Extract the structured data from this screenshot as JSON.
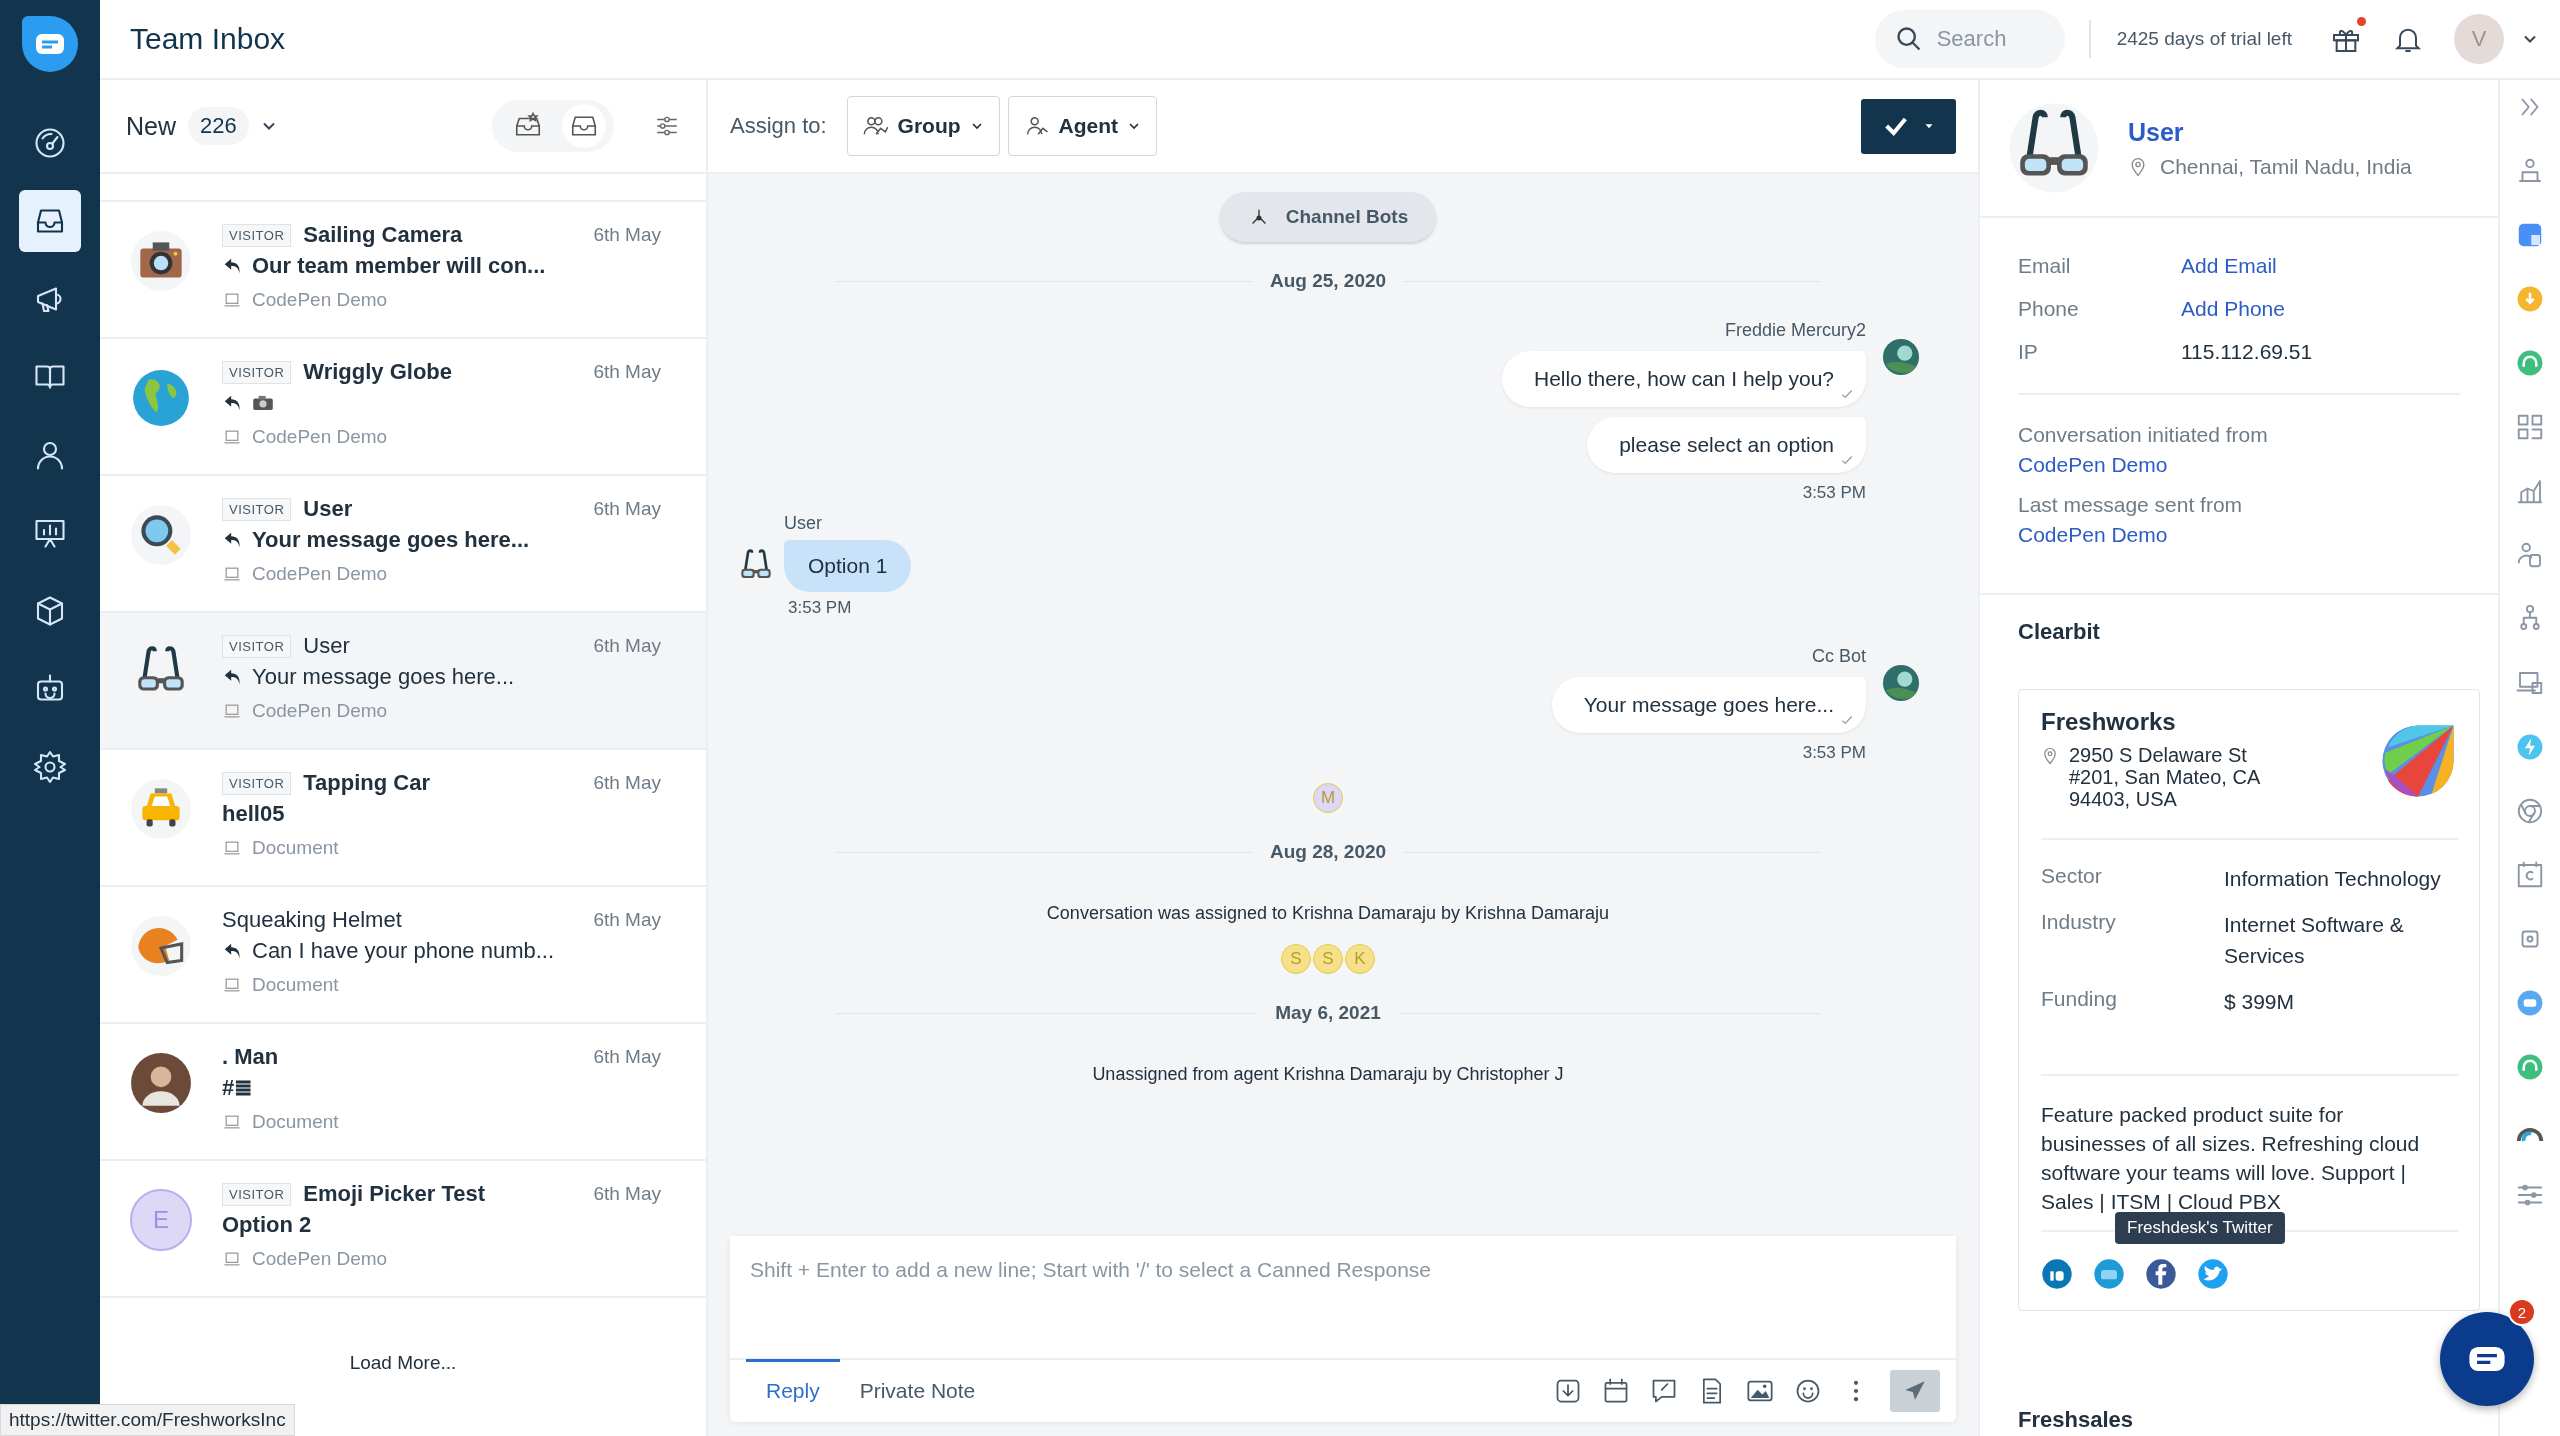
{
  "nav": {
    "items": [
      {
        "selected": false
      },
      {
        "selected": true
      },
      {
        "selected": false
      },
      {
        "selected": false
      },
      {
        "selected": false
      },
      {
        "selected": false
      },
      {
        "selected": false
      },
      {
        "selected": false
      },
      {
        "selected": false
      }
    ]
  },
  "header": {
    "title": "Team Inbox",
    "search": {
      "placeholder": "Search"
    },
    "trial": "2425 days of trial left",
    "gift_notification": true,
    "avatar_initial": "V"
  },
  "list": {
    "filter": "New",
    "count": "226",
    "view_toggle": [
      {
        "selected": false
      },
      {
        "selected": true
      }
    ],
    "load_more": "Load More...",
    "conversations": [
      {
        "badge": "VISITOR",
        "name": "Sailing Camera",
        "unread": true,
        "replied": true,
        "preview": "Our team member will con...",
        "source": "CodePen Demo",
        "date": "6th May",
        "selected": false
      },
      {
        "badge": "VISITOR",
        "name": "Wriggly Globe",
        "unread": true,
        "replied": true,
        "image_attachment": true,
        "source": "CodePen Demo",
        "date": "6th May",
        "selected": false
      },
      {
        "badge": "VISITOR",
        "name": "User",
        "unread": true,
        "replied": true,
        "preview": "Your message goes here...",
        "source": "CodePen Demo",
        "date": "6th May",
        "selected": false
      },
      {
        "badge": "VISITOR",
        "name": "User",
        "unread": false,
        "replied": true,
        "preview": "Your message goes here...",
        "source": "CodePen Demo",
        "date": "6th May",
        "selected": true
      },
      {
        "badge": "VISITOR",
        "name": "Tapping Car",
        "unread": true,
        "replied": false,
        "preview": "hell05",
        "source": "Document",
        "date": "6th May",
        "selected": false
      },
      {
        "name": "Squeaking Helmet",
        "unread": false,
        "replied": true,
        "preview": "Can I have your phone numb...",
        "source": "Document",
        "date": "6th May",
        "selected": false
      },
      {
        "name": ". Man",
        "unread": true,
        "replied": false,
        "preview": "#≣",
        "source": "Document",
        "date": "6th May",
        "selected": false
      },
      {
        "badge": "VISITOR",
        "name": "Emoji Picker Test",
        "avatar_initial": "E",
        "unread": true,
        "replied": false,
        "preview": "Option 2",
        "source": "CodePen Demo",
        "date": "6th May",
        "selected": false
      }
    ]
  },
  "chat": {
    "assign_label": "Assign to:",
    "group": "Group",
    "agent": "Agent",
    "bot_chip": "Channel Bots",
    "messages": [
      {
        "kind": "date",
        "text": "Aug 25, 2020"
      },
      {
        "kind": "agent",
        "sender": "Freddie Mercury2",
        "bubbles": [
          "Hello there, how can I help you?",
          "please select an option"
        ],
        "time": "3:53 PM"
      },
      {
        "kind": "user",
        "sender": "User",
        "bubbles": [
          "Option 1"
        ],
        "time": "3:53 PM"
      },
      {
        "kind": "agent",
        "sender": "Cc Bot",
        "bubbles": [
          "Your message goes here..."
        ],
        "time": "3:53 PM"
      },
      {
        "kind": "participants",
        "initials": [
          {
            "text": "M",
            "color": "#ddd8f6"
          }
        ]
      },
      {
        "kind": "date",
        "text": "Aug 28, 2020"
      },
      {
        "kind": "event",
        "text": "Conversation was assigned to Krishna Damaraju by Krishna Damaraju"
      },
      {
        "kind": "participants",
        "initials": [
          {
            "text": "S",
            "color": "#f7e08a"
          },
          {
            "text": "S",
            "color": "#f7e08a"
          },
          {
            "text": "K",
            "color": "#f7e08a"
          }
        ]
      },
      {
        "kind": "date",
        "text": "May 6, 2021"
      },
      {
        "kind": "event",
        "text": "Unassigned from agent Krishna Damaraju by Christopher J"
      }
    ],
    "composer": {
      "placeholder": "Shift + Enter to add a new line; Start with '/' to select a Canned Response",
      "tabs": [
        {
          "label": "Reply",
          "selected": true
        },
        {
          "label": "Private Note",
          "selected": false
        }
      ]
    }
  },
  "contact": {
    "name": "User",
    "location": "Chennai, Tamil Nadu, India",
    "fields": [
      {
        "label": "Email",
        "value": "Add Email",
        "link": true
      },
      {
        "label": "Phone",
        "value": "Add Phone",
        "link": true
      },
      {
        "label": "IP",
        "value": "115.112.69.51",
        "link": false
      }
    ],
    "origins": [
      {
        "label": "Conversation initiated from",
        "value": "CodePen Demo"
      },
      {
        "label": "Last message sent from",
        "value": "CodePen Demo"
      }
    ]
  },
  "clearbit": {
    "title": "Clearbit",
    "company": "Freshworks",
    "address": "2950 S Delaware St #201, San Mateo, CA 94403, USA",
    "facts": [
      {
        "label": "Sector",
        "value": "Information Technology"
      },
      {
        "label": "Industry",
        "value": "Internet Software & Services"
      },
      {
        "label": "Funding",
        "value": "$ 399M"
      }
    ],
    "description": "Feature packed product suite for businesses of all sizes. Refreshing cloud software your teams will love. Support | Sales | ITSM | Cloud PBX",
    "tooltip": "Freshdesk's Twitter"
  },
  "next_section": "Freshsales",
  "chat_widget": {
    "badge": "2"
  },
  "status_url": "https://twitter.com/FreshworksInc"
}
